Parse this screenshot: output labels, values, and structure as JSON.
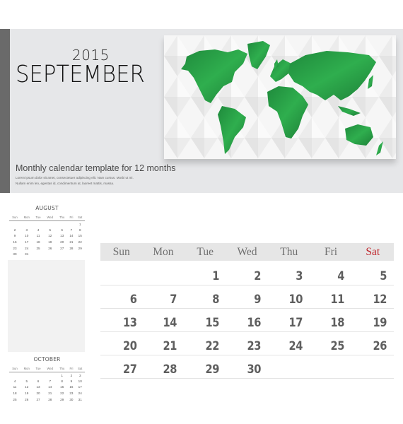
{
  "header": {
    "year": "2015",
    "month": "SEPTEMBER",
    "subtitle": "Monthly calendar template  for 12 months",
    "lorem_line1": "Lorem ipsum dolor sit amet, consectetuer adipiscing elit. Nam cursus. Morbi ut mi.",
    "lorem_line2": "Nullam enim leo, egestas id, condimentum at, laoreet mattis, massa.",
    "image": "world-map-green-on-diamond-pattern",
    "colors": {
      "map_green": "#2a9a45",
      "band": "#e6e7e9",
      "side_bar": "#6a6a6a"
    }
  },
  "prev_month": {
    "name": "AUGUST",
    "weekdays": [
      "Sun",
      "Mon",
      "Tue",
      "Wed",
      "Thu",
      "Fri",
      "Sat"
    ],
    "weeks": [
      [
        "",
        "",
        "",
        "",
        "",
        "",
        "1"
      ],
      [
        "2",
        "3",
        "4",
        "5",
        "6",
        "7",
        "8"
      ],
      [
        "9",
        "10",
        "11",
        "12",
        "13",
        "14",
        "15"
      ],
      [
        "16",
        "17",
        "18",
        "19",
        "20",
        "21",
        "22"
      ],
      [
        "23",
        "24",
        "25",
        "26",
        "27",
        "28",
        "29"
      ],
      [
        "30",
        "31",
        "",
        "",
        "",
        "",
        ""
      ]
    ]
  },
  "next_month": {
    "name": "OCTOBER",
    "weekdays": [
      "Sun",
      "Mon",
      "Tue",
      "Wed",
      "Thu",
      "Fri",
      "Sat"
    ],
    "weeks": [
      [
        "",
        "",
        "",
        "",
        "1",
        "2",
        "3"
      ],
      [
        "4",
        "5",
        "6",
        "7",
        "8",
        "9",
        "10"
      ],
      [
        "11",
        "12",
        "13",
        "14",
        "15",
        "16",
        "17"
      ],
      [
        "18",
        "19",
        "20",
        "21",
        "22",
        "23",
        "24"
      ],
      [
        "25",
        "26",
        "27",
        "28",
        "29",
        "30",
        "31"
      ]
    ]
  },
  "main_calendar": {
    "weekdays": [
      "Sun",
      "Mon",
      "Tue",
      "Wed",
      "Thu",
      "Fri",
      "Sat"
    ],
    "weekend_color": "#c0272d",
    "weeks": [
      [
        "",
        "",
        "1",
        "2",
        "3",
        "4",
        "5"
      ],
      [
        "6",
        "7",
        "8",
        "9",
        "10",
        "11",
        "12"
      ],
      [
        "13",
        "14",
        "15",
        "16",
        "17",
        "18",
        "19"
      ],
      [
        "20",
        "21",
        "22",
        "23",
        "24",
        "25",
        "26"
      ],
      [
        "27",
        "28",
        "29",
        "30",
        "",
        "",
        ""
      ]
    ]
  }
}
